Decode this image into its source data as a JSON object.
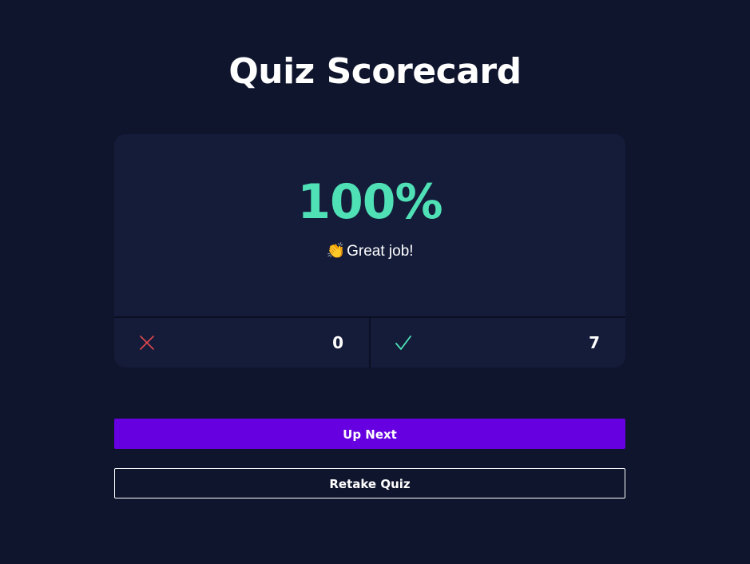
{
  "page": {
    "title": "Quiz Scorecard"
  },
  "scorecard": {
    "score": "100%",
    "feedback_emoji": "👏",
    "feedback_text": "Great job!",
    "incorrect": {
      "icon": "close-icon",
      "count": "0"
    },
    "correct": {
      "icon": "checkmark-icon",
      "count": "7"
    }
  },
  "actions": {
    "up_next_label": "Up Next",
    "retake_label": "Retake Quiz"
  },
  "colors": {
    "background": "#10152e",
    "card": "#141c3a",
    "score": "#4fe0b6",
    "incorrect": "#e0474c",
    "correct": "#4fe0b6",
    "primary_button": "#6600e0"
  }
}
